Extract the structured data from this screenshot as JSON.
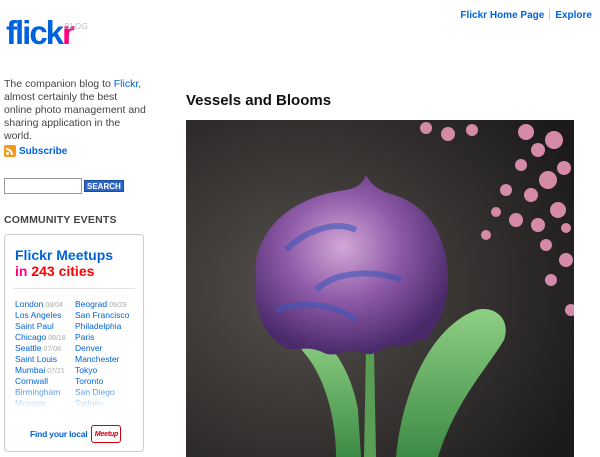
{
  "logo": {
    "main": "flick",
    "accent": "r",
    "tag": "BLOG"
  },
  "nav": {
    "home": "Flickr Home Page",
    "explore": "Explore"
  },
  "sidebar": {
    "intro_before": "The companion blog to ",
    "intro_link": "Flickr",
    "intro_after": ", almost certainly the best online photo management and sharing application in the world.",
    "subscribe": "Subscribe",
    "search_placeholder": "",
    "search_button": "SEARCH",
    "community_heading": "COMMUNITY EVENTS"
  },
  "meetups": {
    "title_line1": "Flickr Meetups",
    "title_in": "in ",
    "title_count": "243 cities",
    "cities": [
      {
        "left": {
          "name": "London",
          "date": "08/04"
        },
        "right": {
          "name": "Beograd",
          "date": "09/29"
        }
      },
      {
        "left": {
          "name": "Los Angeles",
          "date": ""
        },
        "right": {
          "name": "San Francisco",
          "date": ""
        }
      },
      {
        "left": {
          "name": "Saint Paul",
          "date": ""
        },
        "right": {
          "name": "Philadelphia",
          "date": ""
        }
      },
      {
        "left": {
          "name": "Chicago",
          "date": "08/18"
        },
        "right": {
          "name": "Paris",
          "date": ""
        }
      },
      {
        "left": {
          "name": "Seattle",
          "date": "07/08"
        },
        "right": {
          "name": "Denver",
          "date": ""
        }
      },
      {
        "left": {
          "name": "Saint Louis",
          "date": ""
        },
        "right": {
          "name": "Manchester",
          "date": ""
        }
      },
      {
        "left": {
          "name": "Mumbai",
          "date": "07/21"
        },
        "right": {
          "name": "Tokyo",
          "date": ""
        }
      },
      {
        "left": {
          "name": "Cornwall",
          "date": ""
        },
        "right": {
          "name": "Toronto",
          "date": ""
        }
      },
      {
        "left": {
          "name": "Birmingham",
          "date": ""
        },
        "right": {
          "name": "San Diego",
          "date": ""
        }
      },
      {
        "left": {
          "name": "Moscow",
          "date": ""
        },
        "right": {
          "name": "Sydney",
          "date": ""
        }
      }
    ],
    "find_text": "Find your local",
    "meetup_logo": "Meetup"
  },
  "post": {
    "title": "Vessels and Blooms"
  },
  "colors": {
    "flickr_blue": "#0063dc",
    "flickr_pink": "#ff0084",
    "city_count_red": "#ff0000"
  }
}
